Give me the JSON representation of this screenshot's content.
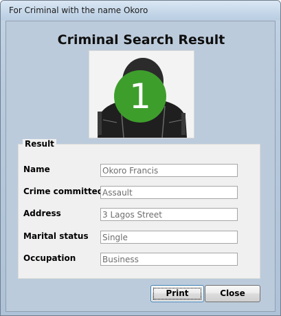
{
  "window": {
    "title": "For Criminal with the name Okoro"
  },
  "heading": "Criminal Search Result",
  "photo": {
    "badge_number": "1",
    "badge_color": "#3e9e2c",
    "image_icon": "mugshot-photo"
  },
  "result": {
    "legend": "Result",
    "fields": [
      {
        "label": "Name",
        "value": "Okoro Francis"
      },
      {
        "label": "Crime committed",
        "value": "Assault"
      },
      {
        "label": "Address",
        "value": "3 Lagos Street"
      },
      {
        "label": "Marital status",
        "value": "Single"
      },
      {
        "label": "Occupation",
        "value": "Business"
      }
    ]
  },
  "buttons": {
    "print": "Print",
    "close": "Close"
  }
}
